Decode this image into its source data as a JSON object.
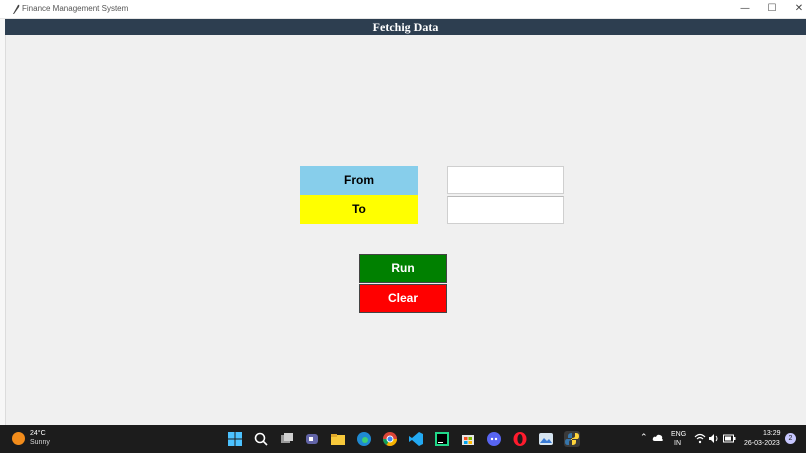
{
  "window": {
    "title": "Finance Management System",
    "minimize_glyph": "—",
    "maximize_glyph": "☐",
    "close_glyph": "✕"
  },
  "header": {
    "title": "Fetchig Data"
  },
  "form": {
    "from_label": "From",
    "to_label": "To",
    "from_value": "",
    "to_value": ""
  },
  "buttons": {
    "run": "Run",
    "clear": "Clear"
  },
  "colors": {
    "header_bg": "#2d3e50",
    "from_bg": "#87ceeb",
    "to_bg": "#ffff00",
    "run_bg": "#008000",
    "clear_bg": "#ff0000"
  },
  "taskbar": {
    "weather_temp": "24°C",
    "weather_desc": "Sunny",
    "pinned_icons": [
      "windows-start-icon",
      "search-icon",
      "task-view-icon",
      "teams-icon",
      "file-explorer-icon",
      "edge-icon",
      "chrome-icon",
      "vscode-icon",
      "pycharm-icon",
      "store-icon",
      "discord-icon",
      "opera-icon",
      "photos-icon",
      "python-icon"
    ],
    "lang_line1": "ENG",
    "lang_line2": "IN",
    "time": "13:29",
    "date": "26-03-2023",
    "notification_count": "2"
  }
}
